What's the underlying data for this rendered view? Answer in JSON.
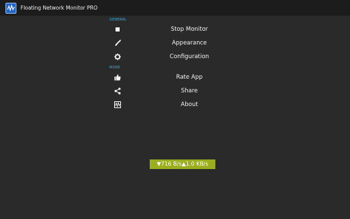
{
  "app": {
    "title": "Floating Network Monitor PRO"
  },
  "sections": {
    "general": {
      "header": "GENERAL",
      "items": [
        {
          "label": "Stop Monitor",
          "icon": "stop-icon"
        },
        {
          "label": "Appearance",
          "icon": "brush-icon"
        },
        {
          "label": "Configuration",
          "icon": "gear-icon"
        }
      ]
    },
    "more": {
      "header": "MORE",
      "items": [
        {
          "label": "Rate App",
          "icon": "thumbs-up-icon"
        },
        {
          "label": "Share",
          "icon": "share-icon"
        },
        {
          "label": "About",
          "icon": "about-app-icon"
        }
      ]
    }
  },
  "speed": {
    "down": "▼716 B/s",
    "up": "▲1.0 KB/s"
  },
  "colors": {
    "accent": "#33b5e5",
    "badge": "#9bae1e",
    "background": "#2a2a2a"
  }
}
